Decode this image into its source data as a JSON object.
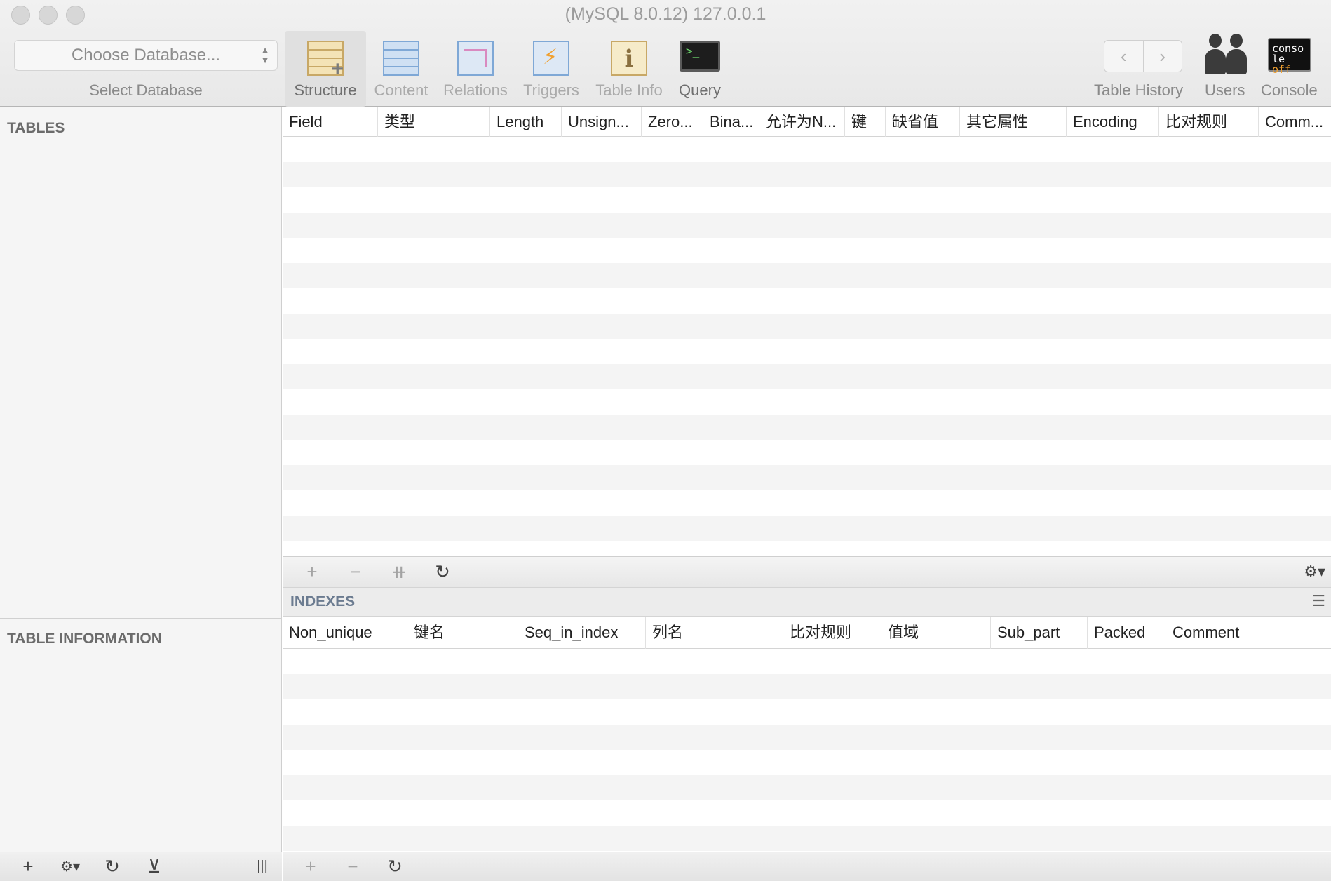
{
  "window": {
    "title": "(MySQL 8.0.12) 127.0.0.1"
  },
  "database_selector": {
    "placeholder": "Choose Database...",
    "caption": "Select Database"
  },
  "toolbar": {
    "tabs": [
      {
        "label": "Structure",
        "icon": "structure-icon"
      },
      {
        "label": "Content",
        "icon": "content-icon"
      },
      {
        "label": "Relations",
        "icon": "relations-icon"
      },
      {
        "label": "Triggers",
        "icon": "triggers-icon"
      },
      {
        "label": "Table Info",
        "icon": "table-info-icon"
      },
      {
        "label": "Query",
        "icon": "query-icon"
      }
    ],
    "history_label": "Table History",
    "back_glyph": "‹",
    "forward_glyph": "›",
    "users_label": "Users",
    "console_label": "Console",
    "console_icon_text_top": "conso",
    "console_icon_text_bottom_left": "le",
    "console_icon_text_bottom_right": "off"
  },
  "sidebar": {
    "tables_heading": "TABLES",
    "table_info_heading": "TABLE INFORMATION"
  },
  "structure_table": {
    "columns": [
      "Field",
      "类型",
      "Length",
      "Unsign...",
      "Zero...",
      "Bina...",
      "允许为N...",
      "键",
      "缺省值",
      "其它属性",
      "Encoding",
      "比对规则",
      "Comm..."
    ]
  },
  "indexes": {
    "heading": "INDEXES",
    "columns": [
      "Non_unique",
      "键名",
      "Seq_in_index",
      "列名",
      "比对规则",
      "值域",
      "Sub_part",
      "Packed",
      "Comment"
    ]
  },
  "glyphs": {
    "add": "+",
    "remove": "−",
    "duplicate": "⧺",
    "refresh": "↻",
    "gear": "⚙▾",
    "filter": "⊻",
    "split": "|||",
    "menu": "☰"
  },
  "colors": {
    "toolbar_bg": "#ececec",
    "sidebar_bg": "#f5f5f5",
    "row_stripe": "#f4f4f4",
    "indexes_heading": "#6b7b90"
  }
}
